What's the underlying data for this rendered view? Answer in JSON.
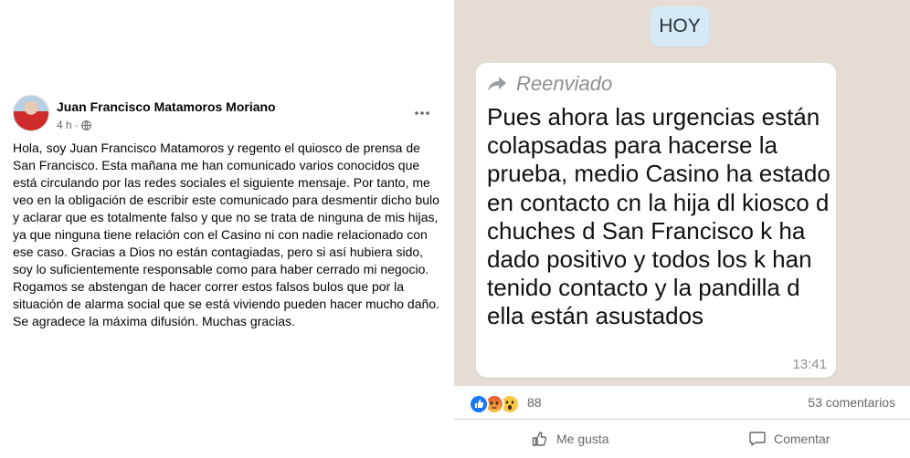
{
  "post": {
    "author": "Juan Francisco Matamoros Moriano",
    "time": "4 h",
    "separator": "·",
    "audience_icon": "globe-icon",
    "menu_icon": "more-options-icon",
    "paragraphs": [
      "Hola, soy Juan Francisco Matamoros y regento el quiosco de prensa de San Francisco. Esta mañana me han comunicado varios conocidos que está circulando por las redes sociales el siguiente mensaje. Por tanto, me veo en la obligación de escribir este comunicado para desmentir dicho bulo y aclarar que es totalmente falso y que no se trata de ninguna de mis hijas, ya que ninguna tiene relación con el Casino ni con nadie relacionado con ese caso. Gracias a Dios no están contagiadas, pero si así hubiera sido, soy lo suficientemente responsable como para haber cerrado mi negocio.",
      "Rogamos se abstengan de hacer correr estos falsos bulos que por la situación de alarma social que se está viviendo pueden hacer mucho daño.",
      "Se agradece la máxima difusión. Muchas gracias."
    ]
  },
  "chat_image": {
    "date_chip": "HOY",
    "forwarded_label": "Reenviado",
    "forwarded_icon": "forward-arrow-icon",
    "message": "Pues ahora las urgencias están colapsadas para hacerse la prueba, medio Casino ha estado en contacto cn la hija dl kiosco d chuches d San Francisco k ha dado positivo y todos los k han tenido contacto y la pandilla d ella están asustados",
    "time": "13:41",
    "colors": {
      "background": "#e5ddd5",
      "bubble": "#ffffff",
      "date_chip": "#d5eaf6"
    }
  },
  "footer": {
    "reactions": [
      "like-reaction-icon",
      "angry-reaction-icon",
      "wow-reaction-icon"
    ],
    "reaction_count": "88",
    "comments": "53 comentarios",
    "like_label": "Me gusta",
    "comment_label": "Comentar"
  }
}
